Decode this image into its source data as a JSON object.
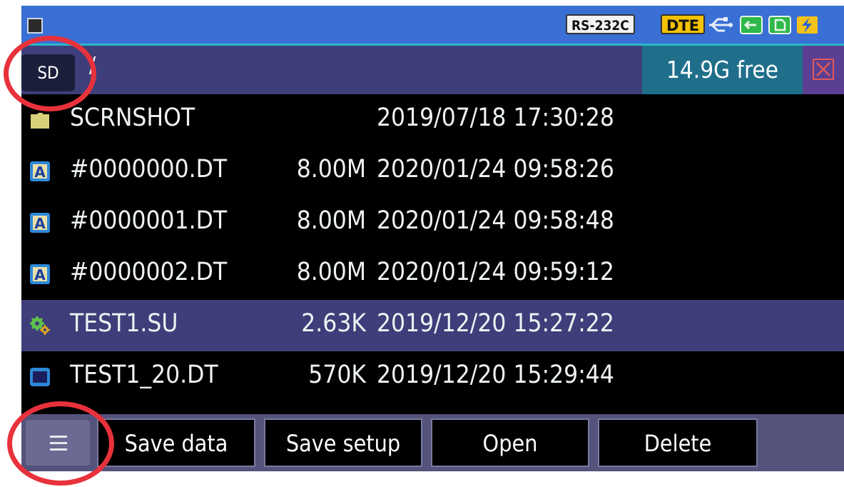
{
  "status_bar": {
    "badges": [
      "RS-232C",
      "DTE"
    ],
    "icons": [
      "stop-icon",
      "usb-icon",
      "lan-icon",
      "sd-card-icon",
      "power-icon"
    ],
    "colors": {
      "bar": "#3a6fd6",
      "dte": "#f5c200"
    }
  },
  "path_bar": {
    "storage_label": "SD",
    "path": "/",
    "free_space": "14.9G free"
  },
  "files": [
    {
      "icon": "folder-icon",
      "name": "SCRNSHOT",
      "size": "",
      "date": "2019/07/18 17:30:28",
      "selected": false
    },
    {
      "icon": "data-file-icon",
      "name": "#0000000.DT",
      "size": "8.00M",
      "date": "2020/01/24 09:58:26",
      "selected": false
    },
    {
      "icon": "data-file-icon",
      "name": "#0000001.DT",
      "size": "8.00M",
      "date": "2020/01/24 09:58:48",
      "selected": false
    },
    {
      "icon": "data-file-icon",
      "name": "#0000002.DT",
      "size": "8.00M",
      "date": "2020/01/24 09:59:12",
      "selected": false
    },
    {
      "icon": "gear-icon",
      "name": "TEST1.SU",
      "size": "2.63K",
      "date": "2019/12/20 15:27:22",
      "selected": true
    },
    {
      "icon": "waveform-file-icon",
      "name": "TEST1_20.DT",
      "size": "570K",
      "date": "2019/12/20 15:29:44",
      "selected": false
    }
  ],
  "bottom_bar": {
    "menu_icon": "menu-icon",
    "buttons": [
      "Save data",
      "Save setup",
      "Open",
      "Delete"
    ]
  },
  "colors": {
    "selected_row": "#3e3e7a",
    "free_box": "#1f6f8b",
    "annotation": "#e8323b"
  }
}
